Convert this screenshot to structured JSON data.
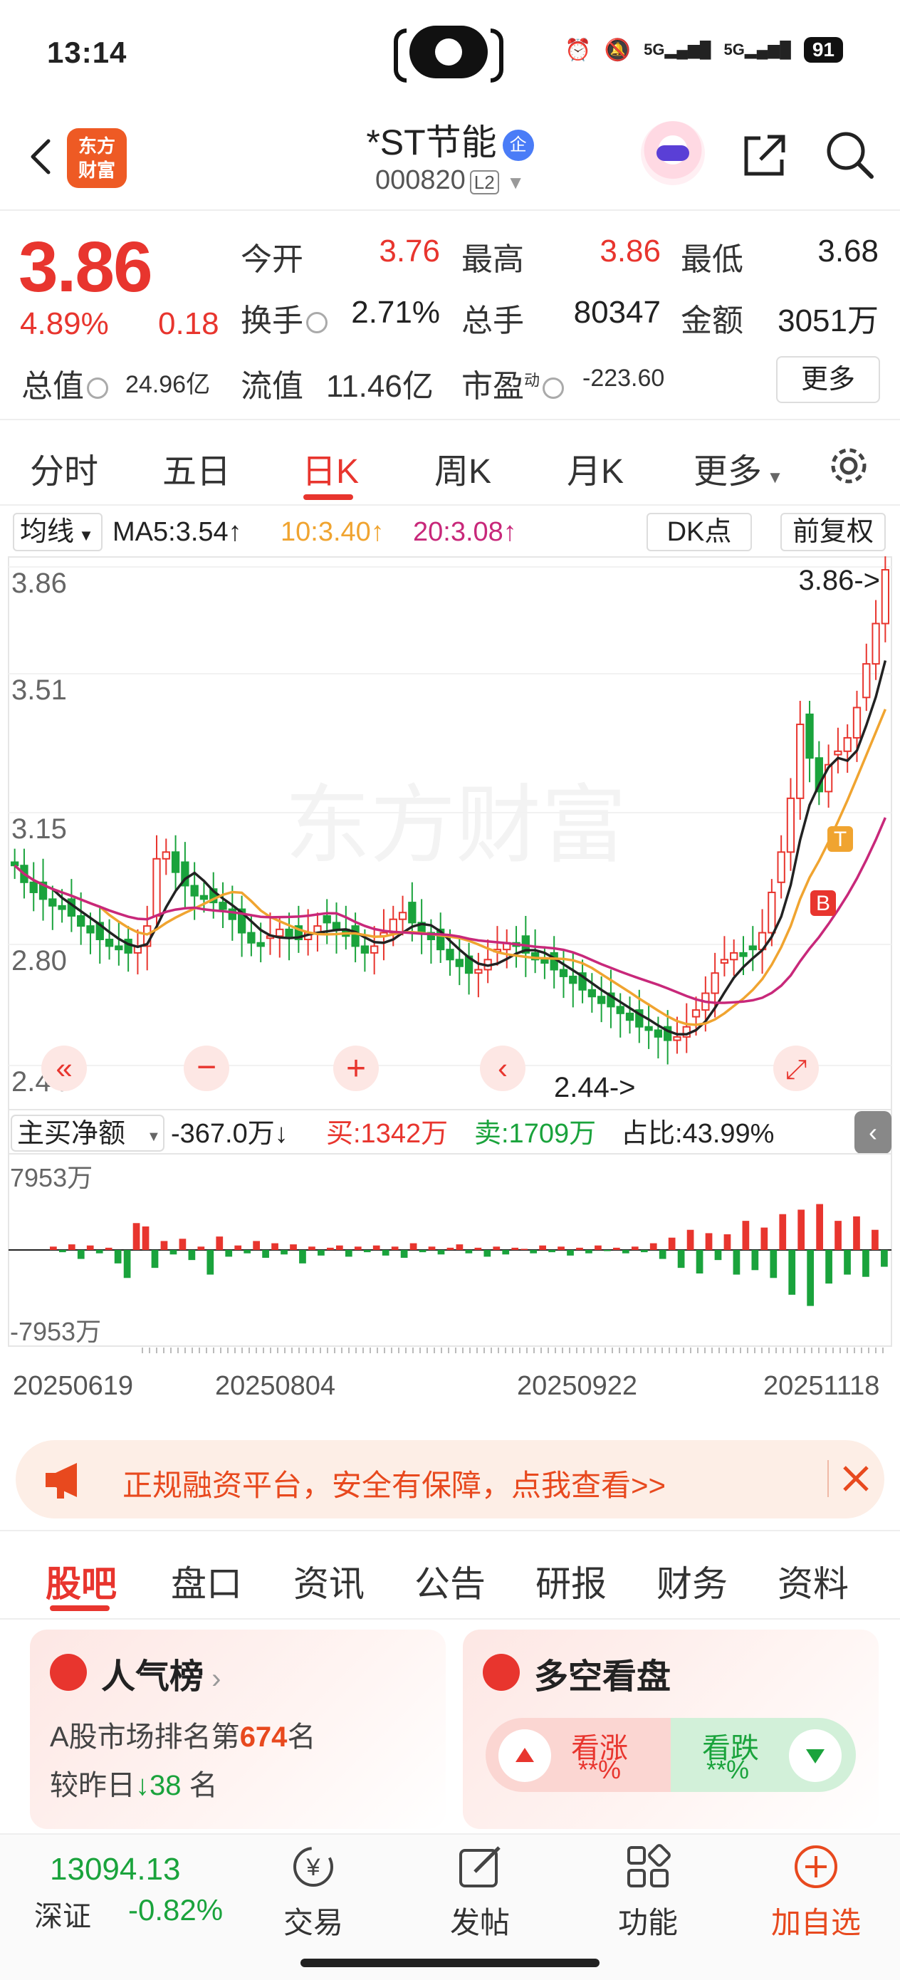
{
  "status_bar": {
    "time": "13:14",
    "battery": "91",
    "net1": "5G",
    "net2": "5G"
  },
  "header": {
    "logo_line1": "东方",
    "logo_line2": "财富",
    "stock_name": "*ST节能",
    "enterprise_badge": "企",
    "stock_code": "000820",
    "level_badge": "L2",
    "icons": [
      "back-arrow-icon",
      "assistant-robot-icon",
      "share-icon",
      "search-icon"
    ]
  },
  "quote": {
    "price": "3.86",
    "change_pct": "4.89%",
    "change_amt": "0.18",
    "fields": [
      {
        "label": "今开",
        "value": "3.76",
        "color": "#e8352e"
      },
      {
        "label": "最高",
        "value": "3.86",
        "color": "#e8352e"
      },
      {
        "label": "最低",
        "value": "3.68",
        "color": "#222222"
      },
      {
        "label": "换手",
        "value": "2.71%",
        "color": "#222222"
      },
      {
        "label": "总手",
        "value": "80347",
        "color": "#222222"
      },
      {
        "label": "金额",
        "value": "3051万",
        "color": "#222222"
      }
    ],
    "market_cap_label": "总值",
    "market_cap_value": "24.96亿",
    "float_cap_label": "流值",
    "float_cap_value": "11.46亿",
    "pe_label": "市盈",
    "pe_super": "动",
    "pe_value": "-223.60",
    "more_label": "更多"
  },
  "period_tabs": {
    "items": [
      "分时",
      "五日",
      "日K",
      "周K",
      "月K",
      "更多"
    ],
    "active": "日K"
  },
  "ma_bar": {
    "selector": "均线",
    "ma5": "MA5:3.54↑",
    "ma10": "10:3.40↑",
    "ma20": "20:3.08↑",
    "dk_label": "DK点",
    "adjust_label": "前复权"
  },
  "chart_data": {
    "type": "candlestick",
    "y_labels": [
      "3.86",
      "3.51",
      "3.15",
      "2.80",
      "2.44"
    ],
    "ylim": [
      2.44,
      3.86
    ],
    "high_marker": "3.86->",
    "low_marker": "2.44->",
    "watermark": "东方财富",
    "signal_labels": [
      "T",
      "B"
    ],
    "colors": {
      "up": "#e8352e",
      "down": "#1aa33c",
      "ma5": "#222222",
      "ma10": "#f0a430",
      "ma20": "#c8287a"
    },
    "x_labels": [
      "20250619",
      "20250804",
      "20250922",
      "20251118"
    ],
    "flow_bar": {
      "selector": "主买净额",
      "net": "-367.0万↓",
      "buy": "买:1342万",
      "sell": "卖:1709万",
      "ratio": "占比:43.99%"
    },
    "flow_ylim_labels": [
      "7953万",
      "-7953万"
    ],
    "closes": [
      2.98,
      2.93,
      2.9,
      2.88,
      2.86,
      2.85,
      2.83,
      2.8,
      2.78,
      2.76,
      2.74,
      2.73,
      2.72,
      2.74,
      2.8,
      3.0,
      3.02,
      2.96,
      2.92,
      2.89,
      2.88,
      2.87,
      2.85,
      2.82,
      2.78,
      2.75,
      2.74,
      2.77,
      2.79,
      2.77,
      2.76,
      2.78,
      2.8,
      2.81,
      2.79,
      2.77,
      2.74,
      2.72,
      2.74,
      2.78,
      2.82,
      2.84,
      2.81,
      2.78,
      2.76,
      2.73,
      2.7,
      2.68,
      2.66,
      2.67,
      2.7,
      2.73,
      2.75,
      2.74,
      2.72,
      2.7,
      2.69,
      2.67,
      2.65,
      2.63,
      2.61,
      2.59,
      2.57,
      2.56,
      2.54,
      2.52,
      2.5,
      2.49,
      2.47,
      2.46,
      2.47,
      2.5,
      2.55,
      2.6,
      2.66,
      2.7,
      2.72,
      2.71,
      2.73,
      2.78,
      2.9,
      3.02,
      3.18,
      3.4,
      3.3,
      3.2,
      3.28,
      3.32,
      3.36,
      3.45,
      3.58,
      3.7,
      3.86
    ],
    "flows": [
      300,
      -200,
      500,
      -800,
      400,
      -300,
      200,
      -1200,
      -2500,
      2400,
      2100,
      -1600,
      800,
      -400,
      1000,
      -900,
      300,
      -2200,
      1200,
      -600,
      400,
      -300,
      800,
      -700,
      600,
      -400,
      500,
      -1200,
      300,
      -500,
      200,
      400,
      -600,
      300,
      -200,
      400,
      -500,
      300,
      -700,
      600,
      -200,
      300,
      -400,
      200,
      500,
      -300,
      200,
      -600,
      300,
      -400,
      200,
      100,
      -300,
      400,
      -200,
      300,
      -500,
      200,
      -300,
      400,
      -100,
      200,
      -300,
      300,
      -200,
      600,
      -800,
      1100,
      -1600,
      1800,
      -2100,
      1500,
      -900,
      1400,
      -2200,
      2600,
      -1800,
      2000,
      -2500,
      3200,
      -4000,
      3600,
      -5000,
      4100,
      -3000,
      2600,
      -2200,
      3000,
      -2400,
      1800,
      -1500
    ]
  },
  "ad_banner": {
    "text": "正规融资平台，安全有保障，点我查看>>"
  },
  "news_tabs": {
    "items": [
      "股吧",
      "盘口",
      "资讯",
      "公告",
      "研报",
      "财务",
      "资料"
    ],
    "active": "股吧"
  },
  "popularity_card": {
    "title": "人气榜",
    "rank_prefix": "A股市场排名第",
    "rank": "674",
    "rank_suffix": "名",
    "change_prefix": "较昨日",
    "change": "38",
    "change_suffix": "名"
  },
  "sentiment_card": {
    "title": "多空看盘",
    "bull_label": "看涨",
    "bull_value": "**%",
    "bear_label": "看跌",
    "bear_value": "**%"
  },
  "bottom_nav": {
    "index_value": "13094.13",
    "index_name": "深证",
    "index_change": "-0.82%",
    "items": [
      {
        "label": "交易",
        "icon": "trade-yen-icon"
      },
      {
        "label": "发帖",
        "icon": "edit-post-icon"
      },
      {
        "label": "功能",
        "icon": "function-grid-icon"
      },
      {
        "label": "加自选",
        "icon": "add-watchlist-icon"
      }
    ]
  }
}
